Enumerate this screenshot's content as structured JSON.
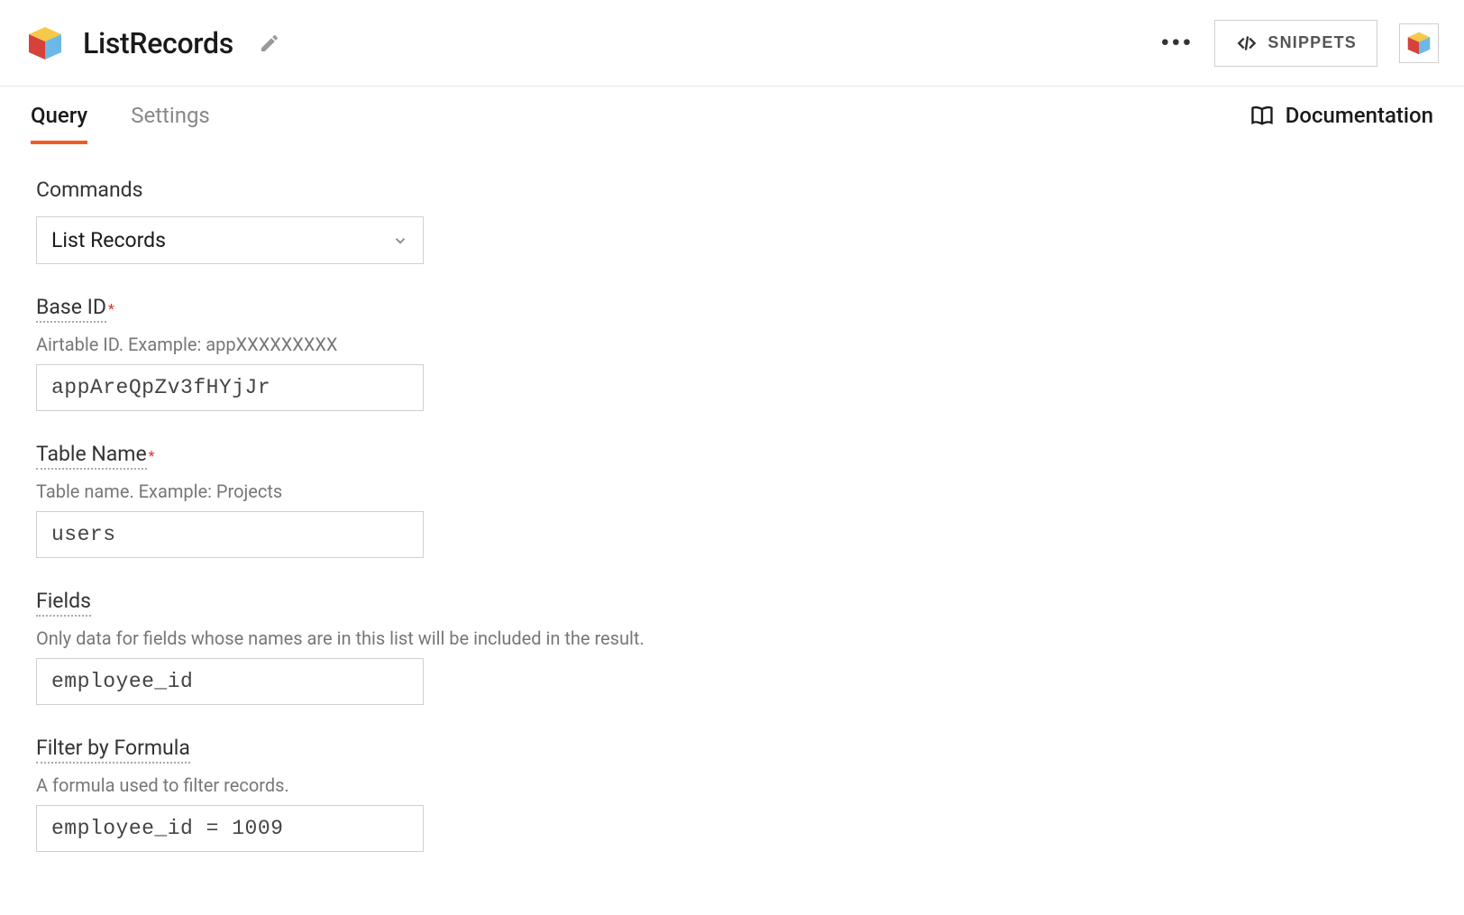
{
  "header": {
    "title": "ListRecords",
    "snippets_label": "SNIPPETS"
  },
  "tabs": {
    "query": "Query",
    "settings": "Settings",
    "documentation": "Documentation"
  },
  "form": {
    "commands": {
      "label": "Commands",
      "value": "List Records"
    },
    "base_id": {
      "label": "Base ID",
      "hint": "Airtable ID. Example: appXXXXXXXXX",
      "value": "appAreQpZv3fHYjJr"
    },
    "table_name": {
      "label": "Table Name",
      "hint": "Table name. Example: Projects",
      "value": "users"
    },
    "fields": {
      "label": "Fields",
      "hint": "Only data for fields whose names are in this list will be included in the result.",
      "value": "employee_id"
    },
    "filter_formula": {
      "label": "Filter by Formula",
      "hint": "A formula used to filter records.",
      "value": "employee_id = 1009"
    }
  }
}
